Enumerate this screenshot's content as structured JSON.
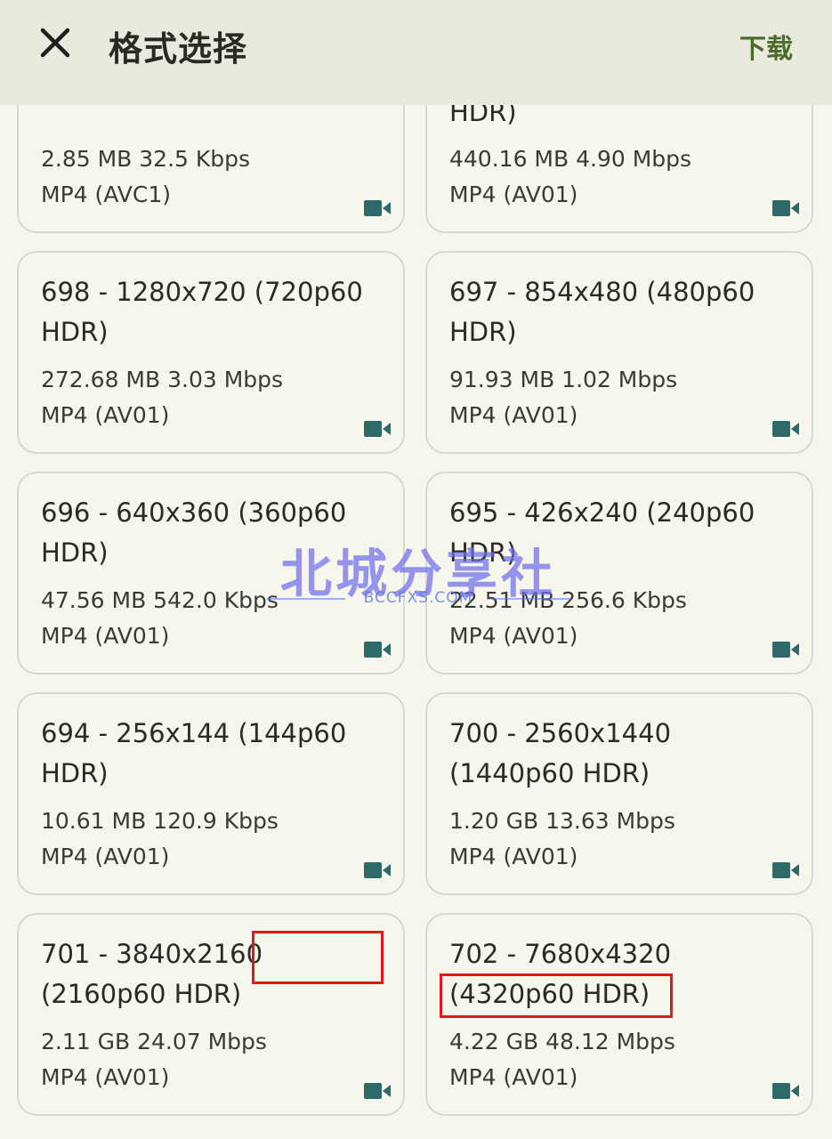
{
  "header": {
    "title": "格式选择",
    "download_label": "下载"
  },
  "formats": [
    {
      "title": "",
      "size": "2.85 MB 32.5 Kbps",
      "codec": "MP4 (AVC1)"
    },
    {
      "title": "HDR)",
      "size": "440.16 MB 4.90 Mbps",
      "codec": "MP4 (AV01)"
    },
    {
      "title": "698 - 1280x720 (720p60 HDR)",
      "size": "272.68 MB 3.03 Mbps",
      "codec": "MP4 (AV01)"
    },
    {
      "title": "697 - 854x480 (480p60 HDR)",
      "size": "91.93 MB 1.02 Mbps",
      "codec": "MP4 (AV01)"
    },
    {
      "title": "696 - 640x360 (360p60 HDR)",
      "size": "47.56 MB 542.0 Kbps",
      "codec": "MP4 (AV01)"
    },
    {
      "title": "695 - 426x240 (240p60 HDR)",
      "size": "22.51 MB 256.6 Kbps",
      "codec": "MP4 (AV01)"
    },
    {
      "title": "694 - 256x144 (144p60 HDR)",
      "size": "10.61 MB 120.9 Kbps",
      "codec": "MP4 (AV01)"
    },
    {
      "title": "700 - 2560x1440 (1440p60 HDR)",
      "size": "1.20 GB 13.63 Mbps",
      "codec": "MP4 (AV01)"
    },
    {
      "title": "701 - 3840x2160 (2160p60 HDR)",
      "size": "2.11 GB 24.07 Mbps",
      "codec": "MP4 (AV01)"
    },
    {
      "title": "702 - 7680x4320 (4320p60 HDR)",
      "size": "4.22 GB 48.12 Mbps",
      "codec": "MP4 (AV01)"
    }
  ],
  "icons": {
    "close": "close-icon",
    "video": "video-camera-icon"
  },
  "colors": {
    "background": "#f6f6ed",
    "header_background": "#e9eadd",
    "accent": "#4e6b2e",
    "icon": "#2f6a6a",
    "highlight": "#e3161b"
  },
  "watermark": {
    "text": "北城分享社",
    "url": "BCCFXS.COM"
  }
}
